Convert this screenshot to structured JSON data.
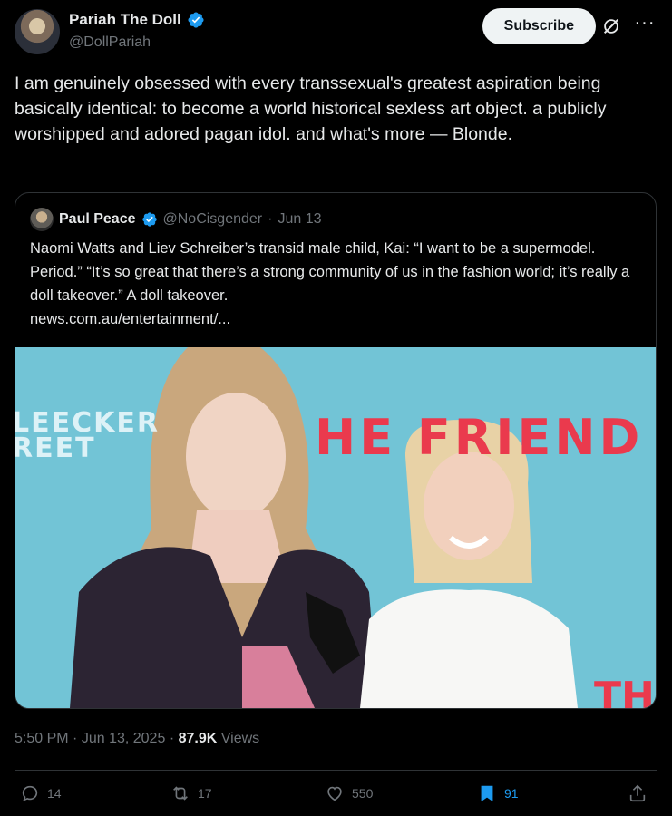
{
  "author": {
    "display_name": "Pariah The Doll",
    "handle": "@DollPariah"
  },
  "header": {
    "subscribe_label": "Subscribe"
  },
  "tweet": {
    "text": "I am genuinely obsessed with every transsexual's greatest aspiration being basically identical: to become a world historical sexless art object. a publicly worshipped and adored pagan idol. and what's more — Blonde."
  },
  "quote": {
    "display_name": "Paul Peace",
    "handle": "@NoCisgender",
    "separator": "·",
    "date": "Jun 13",
    "text": "Naomi Watts and Liev Schreiber’s transid male child, Kai: “I want to be a supermodel. Period.” “It’s so great that there’s a strong community of us in the fashion world; it’s really a doll takeover.” A doll takeover.",
    "link": "news.com.au/entertainment/...",
    "image_text": {
      "bleecker_line1": "LEECKER",
      "bleecker_line2": "REET",
      "friend": "HE FRIEND",
      "corner": "TH"
    }
  },
  "meta": {
    "time": "5:50 PM",
    "separator": "·",
    "date": "Jun 13, 2025",
    "separator2": "·",
    "views_count": "87.9K",
    "views_label": "Views"
  },
  "actions": {
    "replies": "14",
    "reposts": "17",
    "likes": "550",
    "bookmarks": "91"
  },
  "colors": {
    "background": "#000000",
    "text": "#e7e9ea",
    "muted": "#71767b",
    "accent": "#1d9bf0",
    "border": "#2f3336"
  },
  "icons": [
    "verified-badge-icon",
    "grok-icon",
    "more-icon",
    "reply-icon",
    "repost-icon",
    "like-icon",
    "bookmark-icon",
    "share-icon"
  ]
}
